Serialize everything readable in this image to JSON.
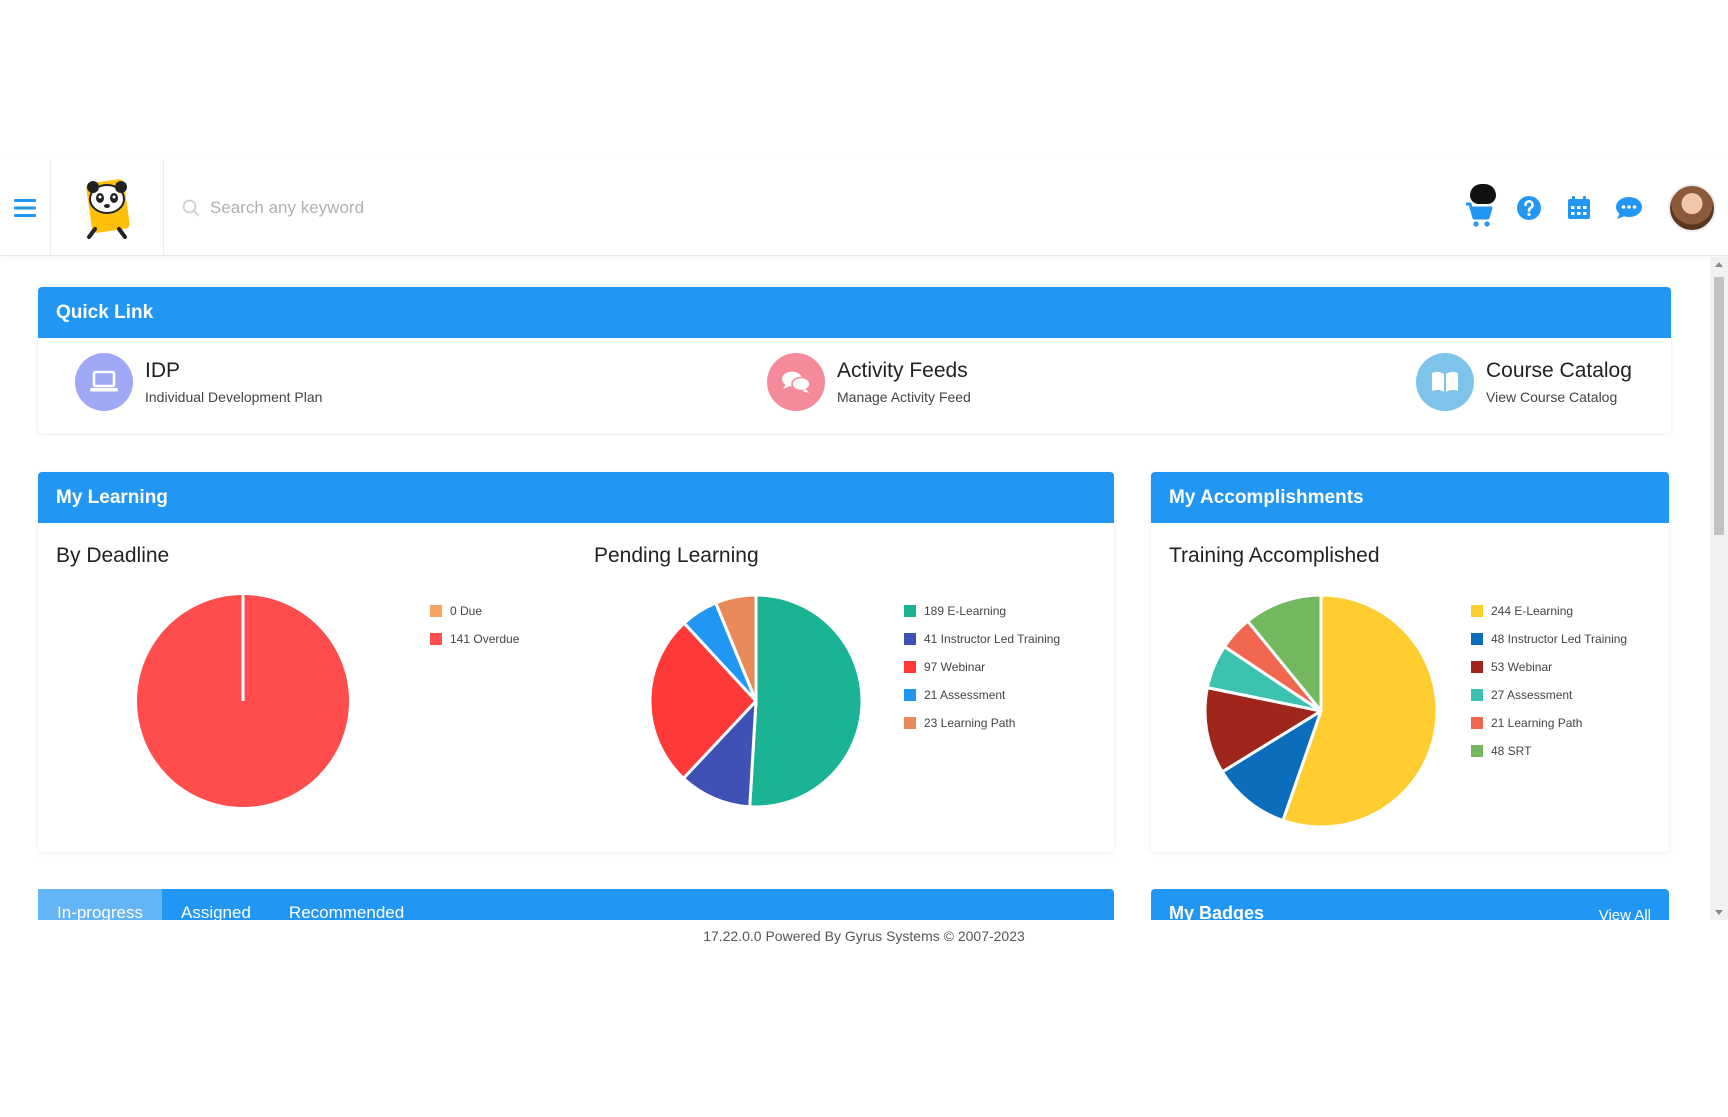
{
  "header": {
    "search_placeholder": "Search any keyword",
    "icons": [
      "menu-icon",
      "cart-icon",
      "help-icon",
      "calendar-icon",
      "chat-icon"
    ]
  },
  "quick_link": {
    "title": "Quick Link",
    "items": [
      {
        "title": "IDP",
        "subtitle": "Individual Development Plan",
        "icon": "laptop-icon",
        "color": "#9fa8f5"
      },
      {
        "title": "Activity Feeds",
        "subtitle": "Manage Activity Feed",
        "icon": "chat-bubbles-icon",
        "color": "#f58a9a"
      },
      {
        "title": "Course Catalog",
        "subtitle": "View Course Catalog",
        "icon": "book-icon",
        "color": "#7ec3ea"
      }
    ]
  },
  "my_learning": {
    "title": "My Learning",
    "by_deadline_title": "By Deadline",
    "pending_title": "Pending Learning"
  },
  "accomplishments": {
    "title": "My Accomplishments",
    "training_title": "Training Accomplished"
  },
  "chart_data": [
    {
      "type": "pie",
      "title": "By Deadline",
      "categories": [
        "Due",
        "Overdue"
      ],
      "values": [
        0,
        141
      ],
      "legend": [
        "0 Due",
        "141 Overdue"
      ],
      "colors": [
        "#f4a460",
        "#ff4d4d"
      ]
    },
    {
      "type": "pie",
      "title": "Pending Learning",
      "categories": [
        "E-Learning",
        "Instructor Led Training",
        "Webinar",
        "Assessment",
        "Learning Path"
      ],
      "values": [
        189,
        41,
        97,
        21,
        23
      ],
      "legend": [
        "189 E-Learning",
        "41 Instructor Led Training",
        "97 Webinar",
        "21 Assessment",
        "23 Learning Path"
      ],
      "colors": [
        "#1ab394",
        "#3f51b5",
        "#ff3838",
        "#2196f3",
        "#e8895a"
      ]
    },
    {
      "type": "pie",
      "title": "Training Accomplished",
      "categories": [
        "E-Learning",
        "Instructor Led Training",
        "Webinar",
        "Assessment",
        "Learning Path",
        "SRT"
      ],
      "values": [
        244,
        48,
        53,
        27,
        21,
        48
      ],
      "legend": [
        "244 E-Learning",
        "48 Instructor Led Training",
        "53 Webinar",
        "27 Assessment",
        "21 Learning Path",
        "48 SRT"
      ],
      "colors": [
        "#ffcd30",
        "#0a6ebd",
        "#a0251a",
        "#3cc3b0",
        "#f0664f",
        "#73b85f"
      ]
    }
  ],
  "tabs": [
    "In-progress",
    "Assigned",
    "Recommended"
  ],
  "badges": {
    "title": "My Badges",
    "view_all": "View All"
  },
  "footer": "17.22.0.0 Powered By Gyrus Systems © 2007-2023"
}
